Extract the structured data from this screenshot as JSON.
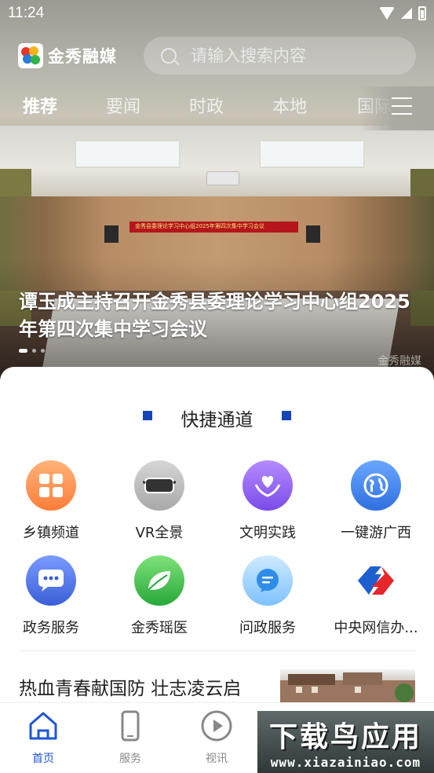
{
  "status_bar": {
    "time": "11:24"
  },
  "header": {
    "logo_text": "金秀融媒",
    "search_placeholder": "请输入搜索内容"
  },
  "tabs": [
    {
      "label": "推荐",
      "active": true
    },
    {
      "label": "要闻"
    },
    {
      "label": "时政"
    },
    {
      "label": "本地"
    },
    {
      "label": "国际"
    }
  ],
  "hero": {
    "banner_text": "金秀县委理论学习中心组2025年第四次集中学习会议",
    "headline": "谭玉成主持召开金秀县委理论学习中心组2025年第四次集中学习会议",
    "watermark": "金秀融媒"
  },
  "quick_access": {
    "title": "快捷通道",
    "items": [
      {
        "label": "乡镇频道",
        "icon": "grid-apps-icon",
        "color": "#ff8a3a"
      },
      {
        "label": "VR全景",
        "icon": "vr-headset-icon",
        "color": "#9b9b9b"
      },
      {
        "label": "文明实践",
        "icon": "heart-hands-icon",
        "color": "#8a5cf0"
      },
      {
        "label": "一键游广西",
        "icon": "globe-icon",
        "color": "#3a7de8"
      },
      {
        "label": "政务服务",
        "icon": "chat-bubble-icon",
        "color": "#4a6ee0"
      },
      {
        "label": "金秀瑶医",
        "icon": "leaf-icon",
        "color": "#3cb84a"
      },
      {
        "label": "问政服务",
        "icon": "message-icon",
        "color": "#3aa0f0"
      },
      {
        "label": "中央网信办...",
        "icon": "cac-logo-icon",
        "color": "#e5262b"
      }
    ]
  },
  "news": {
    "title": "热血青春献国防 壮志凌云启"
  },
  "bottom_nav": [
    {
      "label": "首页",
      "icon": "home-icon",
      "active": true
    },
    {
      "label": "服务",
      "icon": "phone-icon"
    },
    {
      "label": "视讯",
      "icon": "play-icon"
    }
  ],
  "watermark": {
    "big": "下载鸟应用",
    "small": "www.xiazainiao.com"
  },
  "colors": {
    "accent": "#1e56d8",
    "section_marker": "#1846b8"
  }
}
